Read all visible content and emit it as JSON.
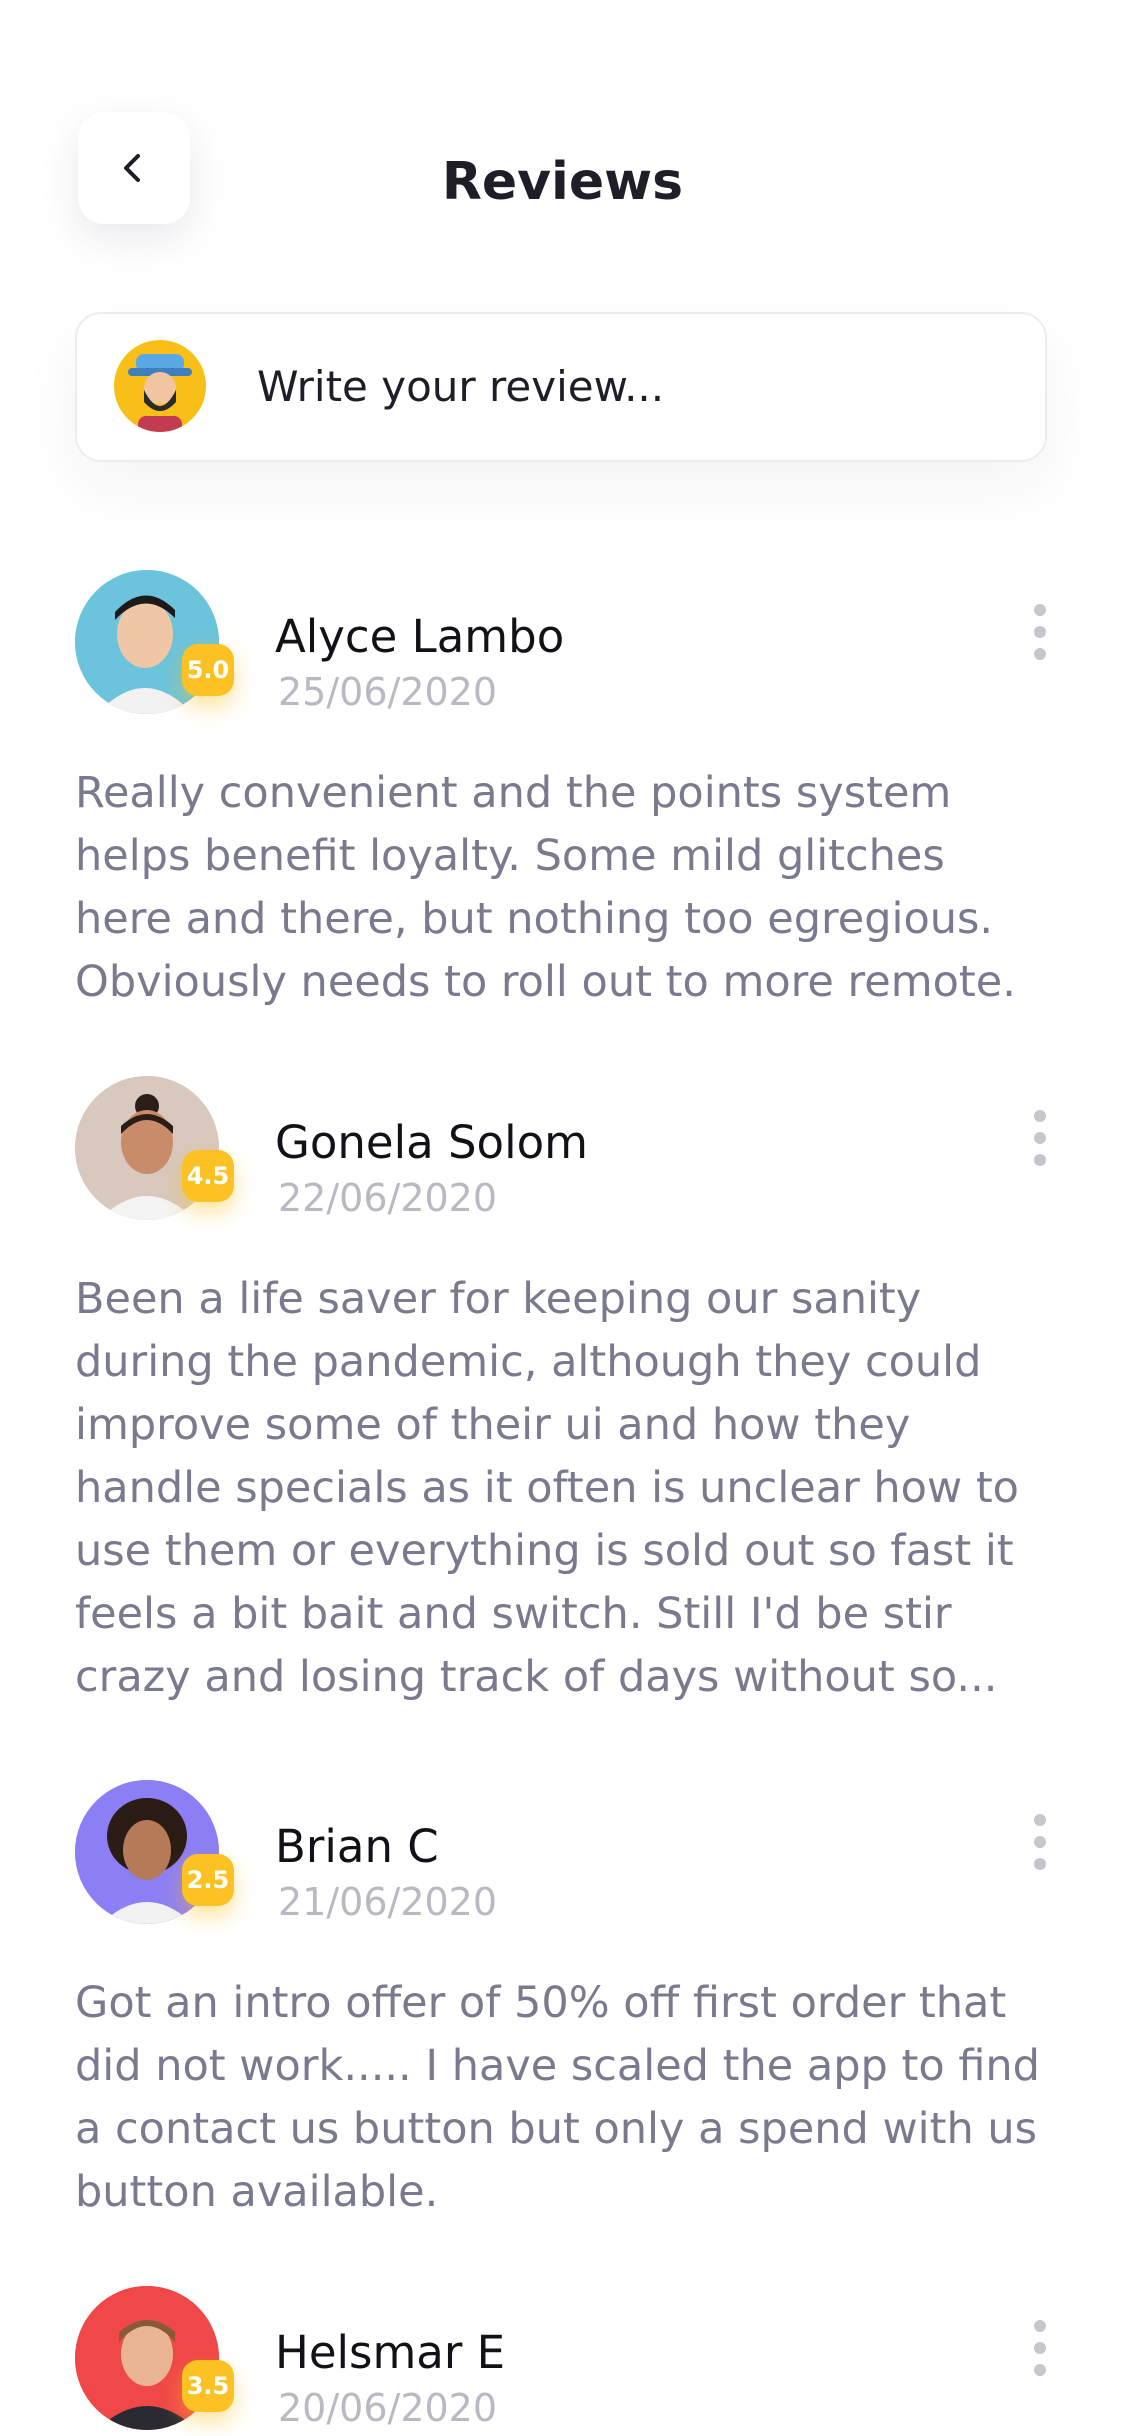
{
  "header": {
    "title": "Reviews"
  },
  "compose": {
    "placeholder": "Write your review..."
  },
  "reviews": [
    {
      "name": "Alyce Lambo",
      "date": "25/06/2020",
      "rating": "5.0",
      "text": "Really convenient and the points system helps benefit loyalty. Some mild glitches here and there, but nothing too egregious. Obviously needs to roll out to more remote."
    },
    {
      "name": "Gonela Solom",
      "date": "22/06/2020",
      "rating": "4.5",
      "text": "Been a life saver for keeping our sanity during the pandemic, although they could improve some of their ui and how they handle specials as it often is unclear how to use them or everything is sold out so fast it feels a bit bait and switch. Still I'd be stir crazy and losing track of days without so..."
    },
    {
      "name": "Brian C",
      "date": "21/06/2020",
      "rating": "2.5",
      "text": "Got an intro offer of 50% off first order that did not work..... I have scaled the app to find a contact us button but only a spend with us button available."
    },
    {
      "name": "Helsmar E",
      "date": "20/06/2020",
      "rating": "3.5",
      "text": ""
    }
  ],
  "colors": {
    "accent": "#fcc224",
    "text_muted": "#7a7a8f",
    "date": "#b9b9c3"
  },
  "icons": {
    "back": "chevron-left-icon",
    "more": "more-vertical-icon"
  }
}
